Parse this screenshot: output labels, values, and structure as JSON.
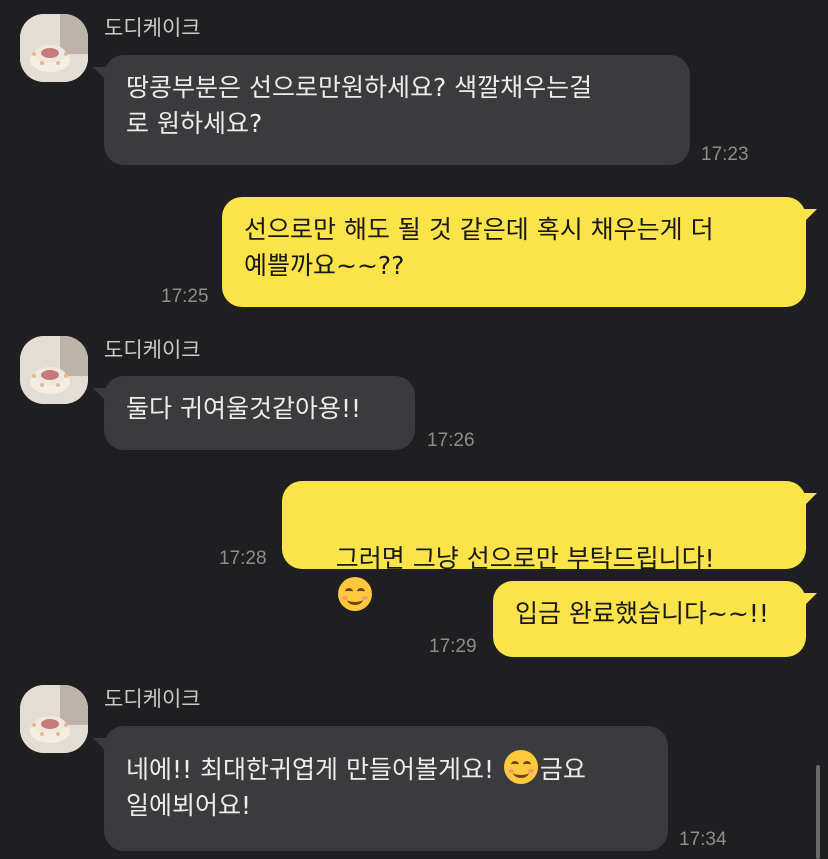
{
  "messages": [
    {
      "sender": "도디케이크",
      "text": "땅콩부분은 선으로만원하세요? 색깔채우는걸\n로 원하세요?",
      "time": "17:23"
    },
    {
      "text": "선으로만 해도 될 것 같은데 혹시 채우는게 더\n예쁠까요~~??",
      "time": "17:25"
    },
    {
      "sender": "도디케이크",
      "text": "둘다 귀여울것같아용!!",
      "time": "17:26"
    },
    {
      "text": "그러면 그냥 선으로만 부탁드립니다!",
      "time": "17:28",
      "emoji": "smiling-face-icon"
    },
    {
      "text": "입금 완료했습니다~~!!",
      "time": "17:29"
    },
    {
      "sender": "도디케이크",
      "text_a": "네에!! 최대한귀엽게 만들어볼게요!",
      "text_b": "금요\n일에뵈어요!",
      "time": "17:34",
      "emoji": "smiling-face-icon"
    }
  ],
  "colors": {
    "background": "#1f1f21",
    "incoming_bubble": "#3b3b3d",
    "outgoing_bubble": "#fae44a"
  }
}
